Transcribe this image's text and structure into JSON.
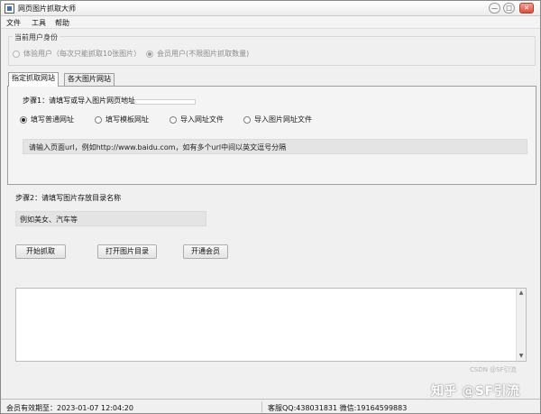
{
  "window": {
    "title": "网页图片抓取大师",
    "controls": {
      "minimize": "—",
      "maximize": "□",
      "close": "✕"
    }
  },
  "menu": {
    "items": [
      "文件",
      "工具",
      "帮助"
    ]
  },
  "identity": {
    "legend": "当前用户身份",
    "options": [
      {
        "label": "体验用户（每次只能抓取10张图片）",
        "checked": false
      },
      {
        "label": "会员用户(不限图片抓取数量)",
        "checked": true
      }
    ]
  },
  "tabs": [
    {
      "label": "指定抓取网站",
      "active": true
    },
    {
      "label": "各大图片网站",
      "active": false
    }
  ],
  "step1": {
    "label": "步骤1：请填写或导入图片网页地址",
    "options": [
      {
        "label": "填写普通网址",
        "checked": true
      },
      {
        "label": "填写模板网址",
        "checked": false
      },
      {
        "label": "导入网址文件",
        "checked": false
      },
      {
        "label": "导入图片网址文件",
        "checked": false
      }
    ],
    "url_placeholder": "请输入页面url，例如http://www.baidu.com，如有多个url中间以英文逗号分隔"
  },
  "step2": {
    "label": "步骤2：请填写图片存放目录名称",
    "dir_placeholder": "例如美女、汽车等"
  },
  "buttons": {
    "start": "开始抓取",
    "open_dir": "打开图片目录",
    "membership": "开通会员"
  },
  "log_area": {
    "scroll_up": "▲",
    "scroll_down": "▼"
  },
  "status": {
    "expiry": "会员有效期至：2023-01-07 12:04:20",
    "contact": "客服QQ:438031831 微信:19164599883"
  },
  "watermarks": {
    "zhihu": "知乎 @SF引流",
    "csdn": "CSDN @SF引流"
  }
}
